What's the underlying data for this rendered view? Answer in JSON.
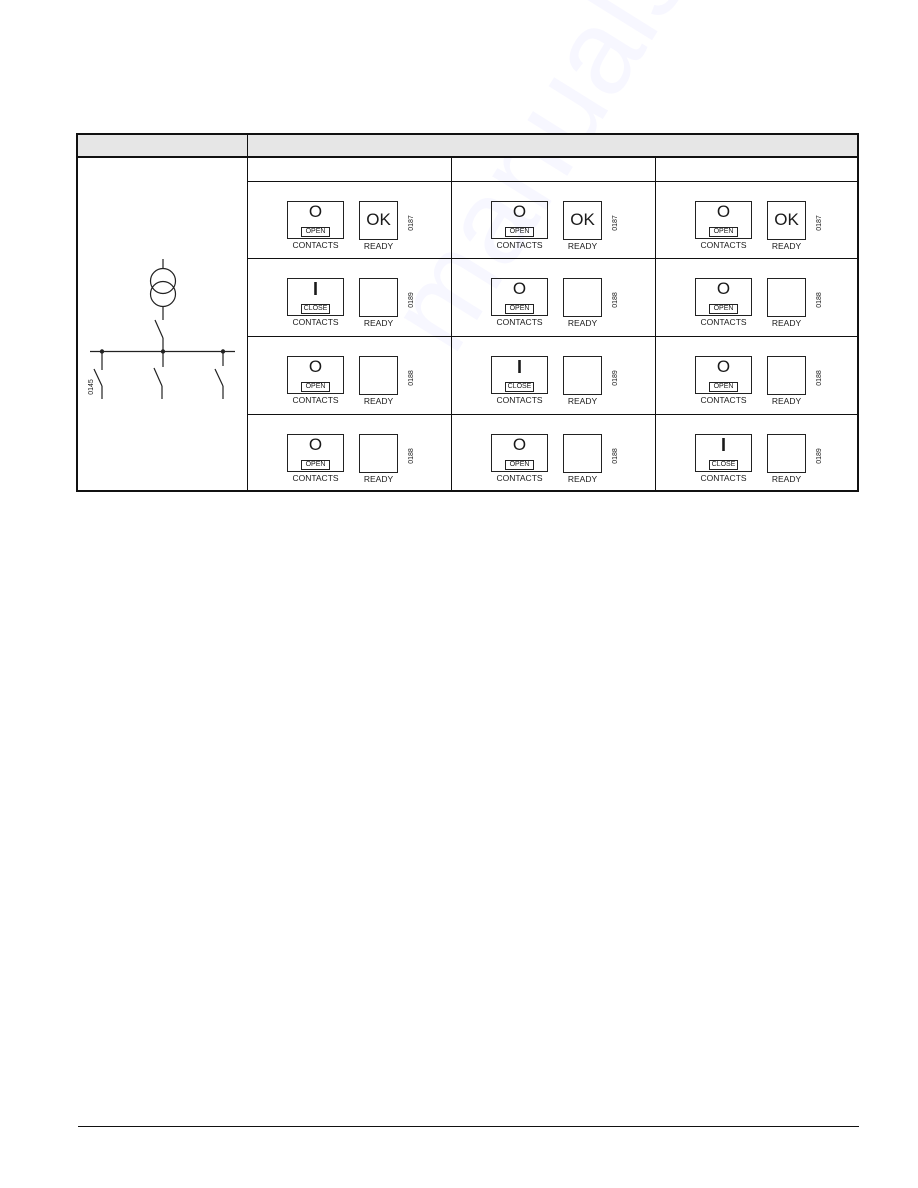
{
  "table": {
    "header": {
      "left": "",
      "right": ""
    },
    "subheader": [
      "",
      "",
      ""
    ],
    "diagram": {
      "name": "single-line-diagram",
      "components": [
        "transformer",
        "incomer-switch",
        "busbar",
        "feeder-switch-1",
        "feeder-switch-2",
        "feeder-switch-3"
      ],
      "figure_code": "0145"
    },
    "rows": [
      {
        "cells": [
          {
            "contacts_glyph": "O",
            "contacts_state": "OPEN",
            "contacts_caption": "CONTACTS",
            "ready_text": "OK",
            "ready_caption": "READY",
            "figure_code": "0187"
          },
          {
            "contacts_glyph": "O",
            "contacts_state": "OPEN",
            "contacts_caption": "CONTACTS",
            "ready_text": "OK",
            "ready_caption": "READY",
            "figure_code": "0187"
          },
          {
            "contacts_glyph": "O",
            "contacts_state": "OPEN",
            "contacts_caption": "CONTACTS",
            "ready_text": "OK",
            "ready_caption": "READY",
            "figure_code": "0187"
          }
        ]
      },
      {
        "cells": [
          {
            "contacts_glyph": "I",
            "contacts_state": "CLOSE",
            "contacts_caption": "CONTACTS",
            "ready_text": "",
            "ready_caption": "READY",
            "figure_code": "0189"
          },
          {
            "contacts_glyph": "O",
            "contacts_state": "OPEN",
            "contacts_caption": "CONTACTS",
            "ready_text": "",
            "ready_caption": "READY",
            "figure_code": "0188"
          },
          {
            "contacts_glyph": "O",
            "contacts_state": "OPEN",
            "contacts_caption": "CONTACTS",
            "ready_text": "",
            "ready_caption": "READY",
            "figure_code": "0188"
          }
        ]
      },
      {
        "cells": [
          {
            "contacts_glyph": "O",
            "contacts_state": "OPEN",
            "contacts_caption": "CONTACTS",
            "ready_text": "",
            "ready_caption": "READY",
            "figure_code": "0188"
          },
          {
            "contacts_glyph": "I",
            "contacts_state": "CLOSE",
            "contacts_caption": "CONTACTS",
            "ready_text": "",
            "ready_caption": "READY",
            "figure_code": "0189"
          },
          {
            "contacts_glyph": "O",
            "contacts_state": "OPEN",
            "contacts_caption": "CONTACTS",
            "ready_text": "",
            "ready_caption": "READY",
            "figure_code": "0188"
          }
        ]
      },
      {
        "cells": [
          {
            "contacts_glyph": "O",
            "contacts_state": "OPEN",
            "contacts_caption": "CONTACTS",
            "ready_text": "",
            "ready_caption": "READY",
            "figure_code": "0188"
          },
          {
            "contacts_glyph": "O",
            "contacts_state": "OPEN",
            "contacts_caption": "CONTACTS",
            "ready_text": "",
            "ready_caption": "READY",
            "figure_code": "0188"
          },
          {
            "contacts_glyph": "I",
            "contacts_state": "CLOSE",
            "contacts_caption": "CONTACTS",
            "ready_text": "",
            "ready_caption": "READY",
            "figure_code": "0189"
          }
        ]
      }
    ]
  },
  "watermark": "manualshive.com"
}
